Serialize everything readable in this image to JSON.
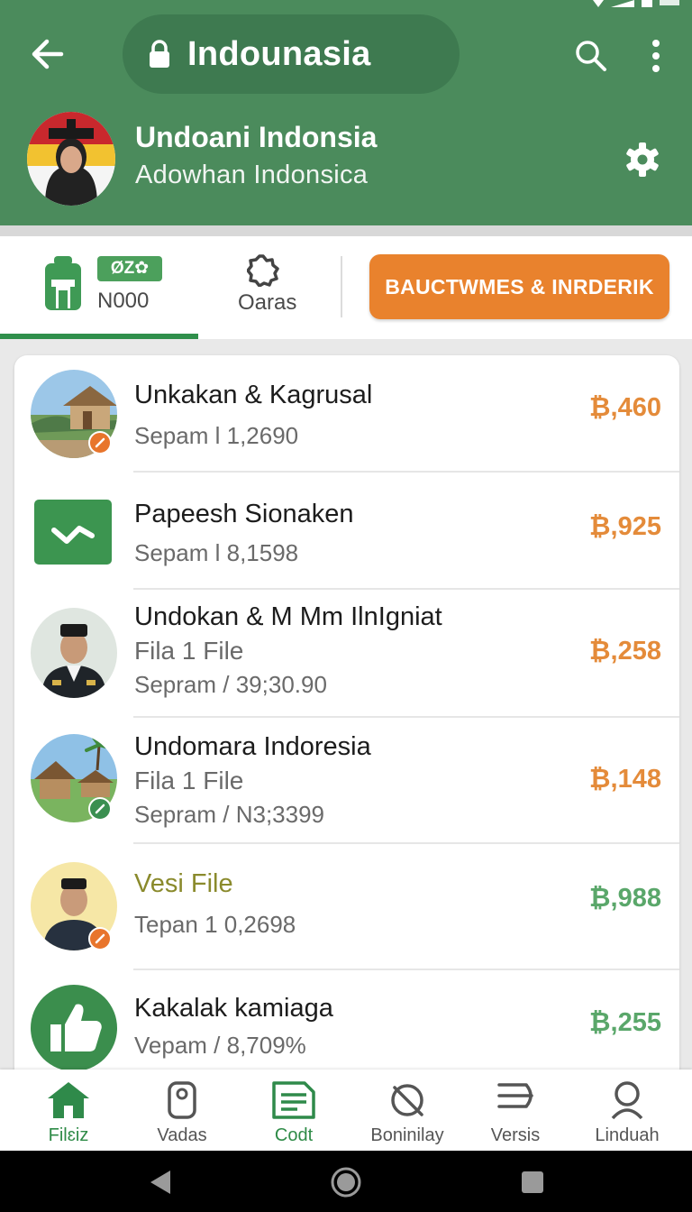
{
  "header": {
    "title": "Indounasia",
    "profile_name": "Undoani Indonsia",
    "profile_subtitle": "Adowhan  Indonsica",
    "colors": {
      "header_bg": "#4b8b5c",
      "pill_bg": "#3e7a50"
    },
    "icons": [
      "back-arrow-icon",
      "lock-icon",
      "search-icon",
      "more-vert-icon",
      "gear-icon"
    ]
  },
  "tabs": {
    "first_badge": "ØZ✿",
    "first_label": "N000",
    "second_label": "Oaras",
    "cta_label": "BAUCTWMES & INRDERIK"
  },
  "list": {
    "items": [
      {
        "title": "Unkakan & Kagrusal",
        "line2": "Sepam l 1,2690",
        "line3": "",
        "value": "₿,460",
        "value_color": "orange"
      },
      {
        "title": "Papeesh Sionaken",
        "line2": "Sepam l 8,1598",
        "line3": "",
        "value": "₿,925",
        "value_color": "orange"
      },
      {
        "title": "Undokan & M Mm IlnIgniat",
        "line2": "Fila 1 File",
        "line3": "Sepram / 39;30.90",
        "value": "₿,258",
        "value_color": "orange"
      },
      {
        "title": "Undomara Indoresia",
        "line2": "Fila 1 File",
        "line3": "Sepram / N3;3399",
        "value": "₿,148",
        "value_color": "orange"
      },
      {
        "title": "Vesi File",
        "line2": "Tepan 1 0,2698",
        "line3": "",
        "value": "₿,988",
        "value_color": "green"
      },
      {
        "title": "Kakalak kamiaga",
        "line2": "Vepam / 8,709%",
        "line3": "",
        "value": "₿,255",
        "value_color": "green"
      }
    ]
  },
  "bottom_nav": {
    "items": [
      {
        "label": "Filɛiz",
        "icon": "home-icon"
      },
      {
        "label": "Vadas",
        "icon": "location-tag-icon"
      },
      {
        "label": "Codt",
        "icon": "document-icon"
      },
      {
        "label": "Boninilay",
        "icon": "no-search-icon"
      },
      {
        "label": "Versis",
        "icon": "menu-lines-icon"
      },
      {
        "label": "Linduah",
        "icon": "user-search-icon"
      }
    ],
    "active_index": 0
  }
}
